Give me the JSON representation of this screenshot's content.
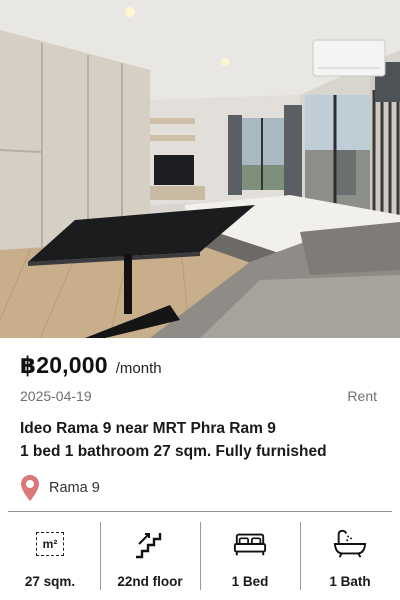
{
  "listing": {
    "price": "฿20,000",
    "period": "/month",
    "date": "2025-04-19",
    "type": "Rent",
    "title_line1": "Ideo Rama 9 near MRT Phra Ram 9",
    "title_line2": "1 bed 1 bathroom 27 sqm. Fully furnished",
    "location": "Rama 9"
  },
  "features": {
    "area_unit": "m²",
    "area": "27 sqm.",
    "floor": "22nd floor",
    "beds": "1 Bed",
    "baths": "1 Bath"
  },
  "icons": [
    "area-icon",
    "stairs-icon",
    "bed-icon",
    "bathtub-icon",
    "location-pin-icon"
  ],
  "colors": {
    "pin": "#d9777a",
    "text": "#1a1a1a",
    "muted": "#707070"
  }
}
